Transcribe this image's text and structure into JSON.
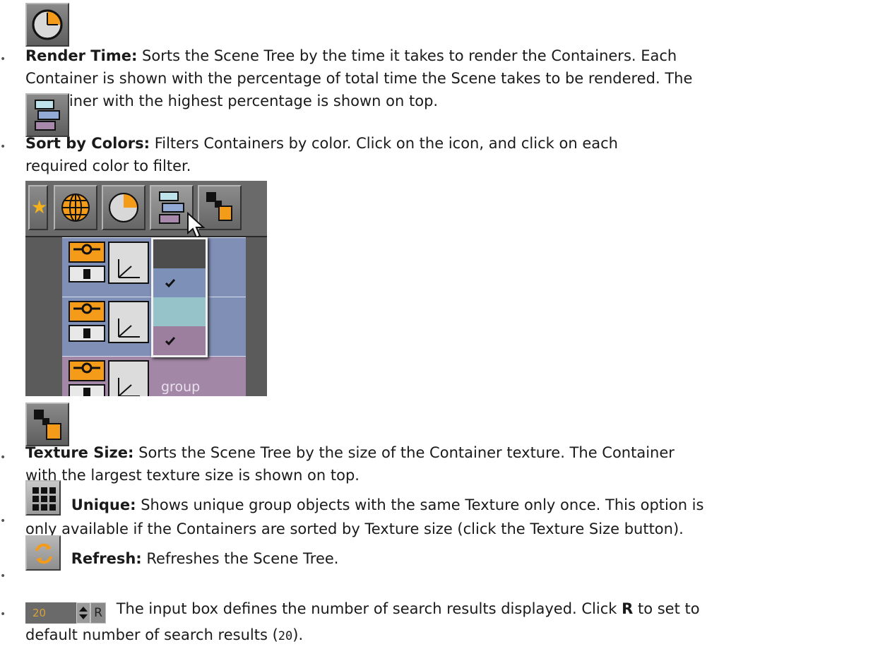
{
  "items": [
    {
      "icon": "render-time-clock-icon",
      "term": "Render Time:",
      "text_lines": [
        "Sorts the Scene Tree by the time it takes to render the Containers. Each",
        "Container is shown with the percentage of total time the Scene takes to be rendered. The",
        "Container with the highest percentage is shown on top."
      ]
    },
    {
      "icon": "sort-by-colors-icon",
      "term": "Sort by Colors:",
      "text_lines": [
        "Filters Containers by color. Click on the icon, and click on each",
        "required color to filter."
      ]
    },
    {
      "icon": "texture-size-icon",
      "term": "Texture Size:",
      "text_lines": [
        "Sorts the Scene Tree by the size of the Container texture. The Container",
        "with the largest texture size is shown on top."
      ]
    },
    {
      "icon": "unique-grid-icon",
      "term": "Unique:",
      "text_lines": [
        "Shows unique group objects with the same Texture only once. This option is",
        "only available if the Containers are sorted by Texture size (click the Texture Size button)."
      ]
    },
    {
      "icon": "refresh-icon",
      "term": "Refresh:",
      "text_lines": [
        "Refreshes the Scene Tree."
      ]
    },
    {
      "icon": "search-results-spinner",
      "term": "",
      "spinner_value": "20",
      "spinner_reset": "R",
      "text_lines_part1": "The input box defines the number of search results displayed. Click",
      "bold_inline": "R",
      "text_lines_part2": "to set to",
      "line2_prefix": "default number of search results (",
      "line2_mono": "20",
      "line2_suffix": ")."
    }
  ],
  "screenshot": {
    "tree_label": "group",
    "menu_colors": [
      "#4d4d4d",
      "#7d90b8",
      "#96c2c9",
      "#9c7e9e"
    ],
    "menu_checked": [
      false,
      true,
      false,
      true
    ],
    "row_colors": [
      "#7f8fb6",
      "#7f8fb6",
      "#a287a6"
    ],
    "accent": "#f59b1a"
  }
}
